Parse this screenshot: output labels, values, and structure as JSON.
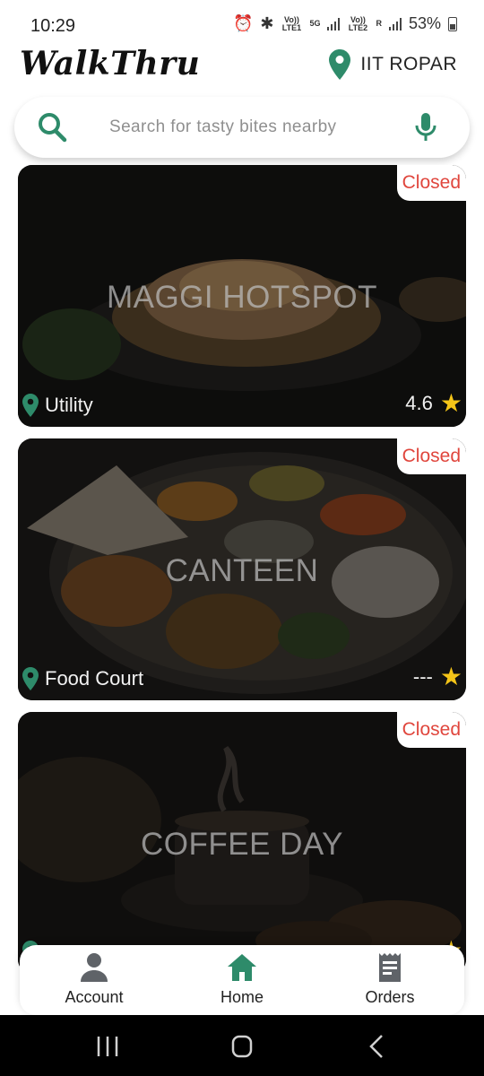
{
  "status_bar": {
    "time": "10:29",
    "sim1": "Vo)) LTE1",
    "net": "5G",
    "sim2": "Vo)) LTE2",
    "sim2_extra": "R",
    "battery": "53%"
  },
  "header": {
    "brand": "WalkThru",
    "location": "IIT ROPAR"
  },
  "search": {
    "placeholder": "Search for tasty bites nearby"
  },
  "cards": [
    {
      "name": "MAGGI HOTSPOT",
      "status": "Closed",
      "location": "Utility",
      "rating": "4.6"
    },
    {
      "name": "CANTEEN",
      "status": "Closed",
      "location": "Food Court",
      "rating": "---"
    },
    {
      "name": "COFFEE DAY",
      "status": "Closed",
      "location": "",
      "rating": ""
    }
  ],
  "bottom_nav": {
    "items": [
      {
        "label": "Account",
        "icon": "person-icon"
      },
      {
        "label": "Home",
        "icon": "home-icon",
        "active": true
      },
      {
        "label": "Orders",
        "icon": "receipt-icon"
      }
    ]
  },
  "colors": {
    "accent": "#2e8b6a",
    "closed": "#e0463d",
    "star": "#f5c518"
  }
}
